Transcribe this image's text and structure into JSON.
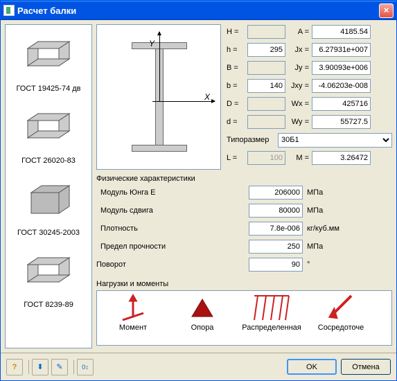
{
  "window": {
    "title": "Расчет балки"
  },
  "sidebar": {
    "items": [
      {
        "label": "ГОСТ 19425-74 дв"
      },
      {
        "label": "ГОСТ 26020-83"
      },
      {
        "label": "ГОСТ 30245-2003"
      },
      {
        "label": "ГОСТ 8239-89"
      }
    ]
  },
  "axes": {
    "x": "X",
    "y": "Y"
  },
  "params": {
    "H": {
      "label": "H =",
      "value": ""
    },
    "h": {
      "label": "h =",
      "value": "295"
    },
    "B": {
      "label": "B =",
      "value": ""
    },
    "b": {
      "label": "b =",
      "value": "140"
    },
    "D": {
      "label": "D =",
      "value": ""
    },
    "d": {
      "label": "d =",
      "value": ""
    },
    "L": {
      "label": "L =",
      "value": "100"
    },
    "A": {
      "label": "A =",
      "value": "4185.54"
    },
    "Jx": {
      "label": "Jx =",
      "value": "6.27931e+007"
    },
    "Jy": {
      "label": "Jy =",
      "value": "3.90093e+006"
    },
    "Jxy": {
      "label": "Jxy =",
      "value": "-4.06203e-008"
    },
    "Wx": {
      "label": "Wx =",
      "value": "425716"
    },
    "Wy": {
      "label": "Wy =",
      "value": "55727.5"
    },
    "M": {
      "label": "M =",
      "value": "3.26472"
    }
  },
  "typosize": {
    "label": "Типоразмер",
    "value": "30Б1"
  },
  "phys": {
    "title": "Физические характеристики",
    "rows": [
      {
        "label": "Модуль Юнга Е",
        "value": "206000",
        "unit": "МПа"
      },
      {
        "label": "Модуль сдвига",
        "value": "80000",
        "unit": "МПа"
      },
      {
        "label": "Плотность",
        "value": "7.8e-006",
        "unit": "кг/куб.мм"
      },
      {
        "label": "Предел прочности",
        "value": "250",
        "unit": "МПа"
      }
    ],
    "rotation": {
      "label": "Поворот",
      "value": "90",
      "unit": "°"
    }
  },
  "loads": {
    "title": "Нагрузки и моменты",
    "items": [
      {
        "label": "Момент"
      },
      {
        "label": "Опора"
      },
      {
        "label": "Распределенная"
      },
      {
        "label": "Сосредоточе"
      }
    ]
  },
  "buttons": {
    "ok": "OK",
    "cancel": "Отмена"
  }
}
